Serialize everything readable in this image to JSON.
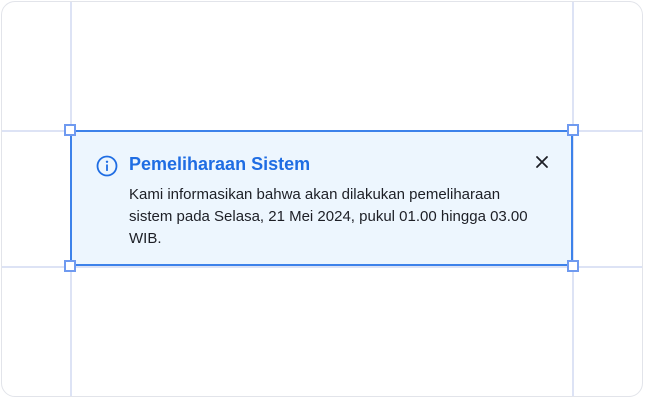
{
  "colors": {
    "accent": "#1f6de3",
    "alert_background": "#edf6fe",
    "alert_border": "#3d82ea",
    "guide_line": "#dde3f5"
  },
  "alert": {
    "icon": "info-icon",
    "title": "Pemeliharaan Sistem",
    "message": "Kami informasikan bahwa akan dilakukan pemeliharaan sistem pada Selasa, 21 Mei 2024, pukul 01.00 hingga 03.00 WIB.",
    "close_icon": "close-icon"
  }
}
